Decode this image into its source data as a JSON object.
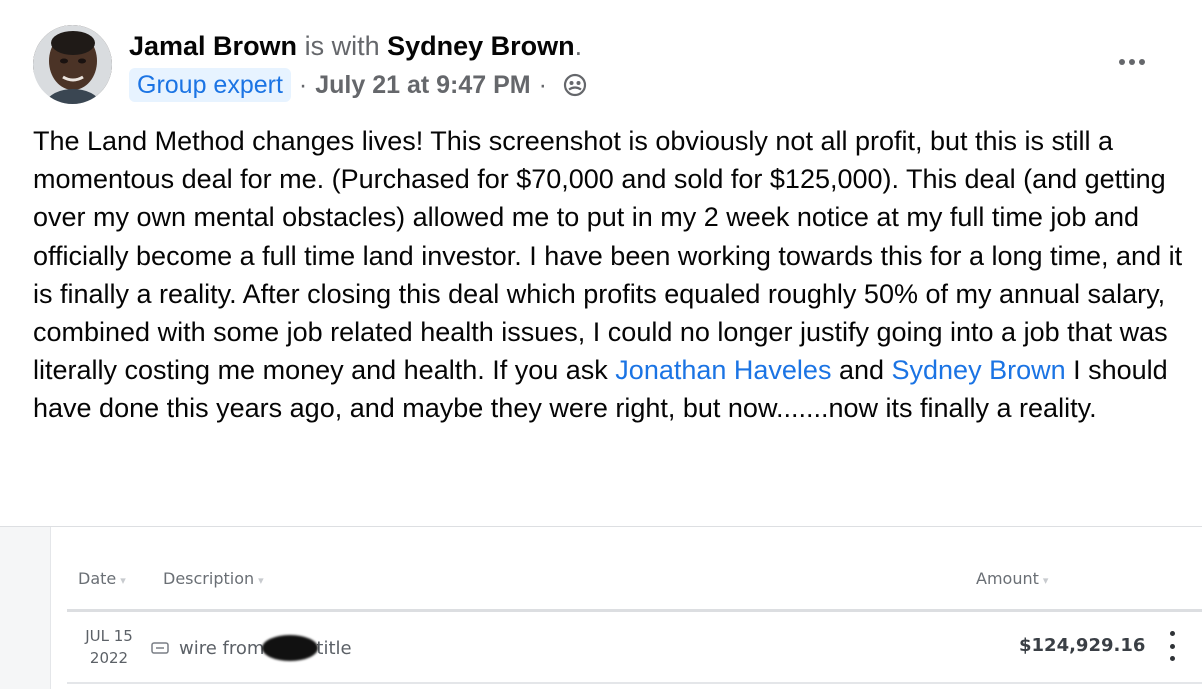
{
  "post": {
    "author": "Jamal Brown",
    "with_text": "is with",
    "tagged": "Sydney Brown",
    "period": ".",
    "badge": "Group expert",
    "separator": "·",
    "timestamp": "July 21 at 9:47 PM",
    "audience_icon": "group-icon",
    "more_icon": "more-horizontal-icon",
    "text": {
      "part1": "The Land Method changes lives!  This screenshot is obviously not all profit, but this is still a momentous deal for me.  (Purchased for $70,000 and sold for $125,000).  This deal (and getting over my own mental obstacles) allowed me to put in my 2 week notice at my full time job and officially become a full time land investor.  I have been working towards this for a long time, and it is finally a reality.  After closing this deal which profits equaled roughly 50% of my annual salary, combined with some job related health issues, I could no longer justify going into a job that was literally costing me money and health. If you ask ",
      "mention1": "Jonathan Haveles",
      "part2": " and ",
      "mention2": "Sydney Brown",
      "part3": "  I should have done this years ago, and maybe they were right, but now.......now its finally a reality."
    }
  },
  "screenshot": {
    "columns": {
      "date": "Date",
      "description": "Description",
      "amount": "Amount"
    },
    "rows": [
      {
        "date_month_day": "JUL 15",
        "date_year": "2022",
        "desc_prefix": "wire from",
        "desc_suffix": "title",
        "amount": "$124,929.16"
      }
    ]
  },
  "colors": {
    "link": "#1b74e4",
    "badge_bg": "#e7f3ff",
    "muted": "#65676b"
  }
}
